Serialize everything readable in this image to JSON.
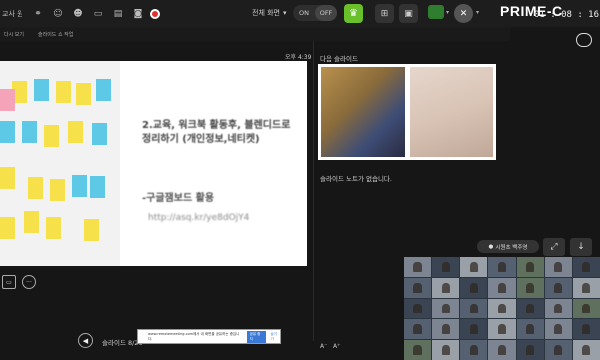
{
  "topbar": {
    "app_name": "교사 원...",
    "view_mode": "전체 화면",
    "on_label": "ON",
    "off_label": "OFF",
    "logo_text": "PRIME-C",
    "elapsed_time": "01 : 08 : 16"
  },
  "substrip": {
    "label_left": "다시 보기",
    "label_right": "슬라이드 쇼 작업"
  },
  "slide": {
    "clock": "오후 4:39",
    "title": "2.교육, 워크북 활동후, 블렌디드로 정리하기 (개인정보,네티켓)",
    "subtitle": "-구글잼보드 활용",
    "url": "http://asq.kr/ye8dOjY4"
  },
  "side": {
    "next_label": "다음 슬라이드",
    "notes_label": "슬라이드 노트가 없습니다."
  },
  "bottom": {
    "slide_counter": "슬라이드 8/26",
    "share_message": "www.remotemeeting.com에서 내 화면을 공유하는 중입니다.",
    "share_stop": "공유 중지",
    "share_hide": "숨기기",
    "font_small": "A⁻",
    "font_large": "A⁺"
  },
  "presenter": {
    "name": "시원초 백주영"
  }
}
